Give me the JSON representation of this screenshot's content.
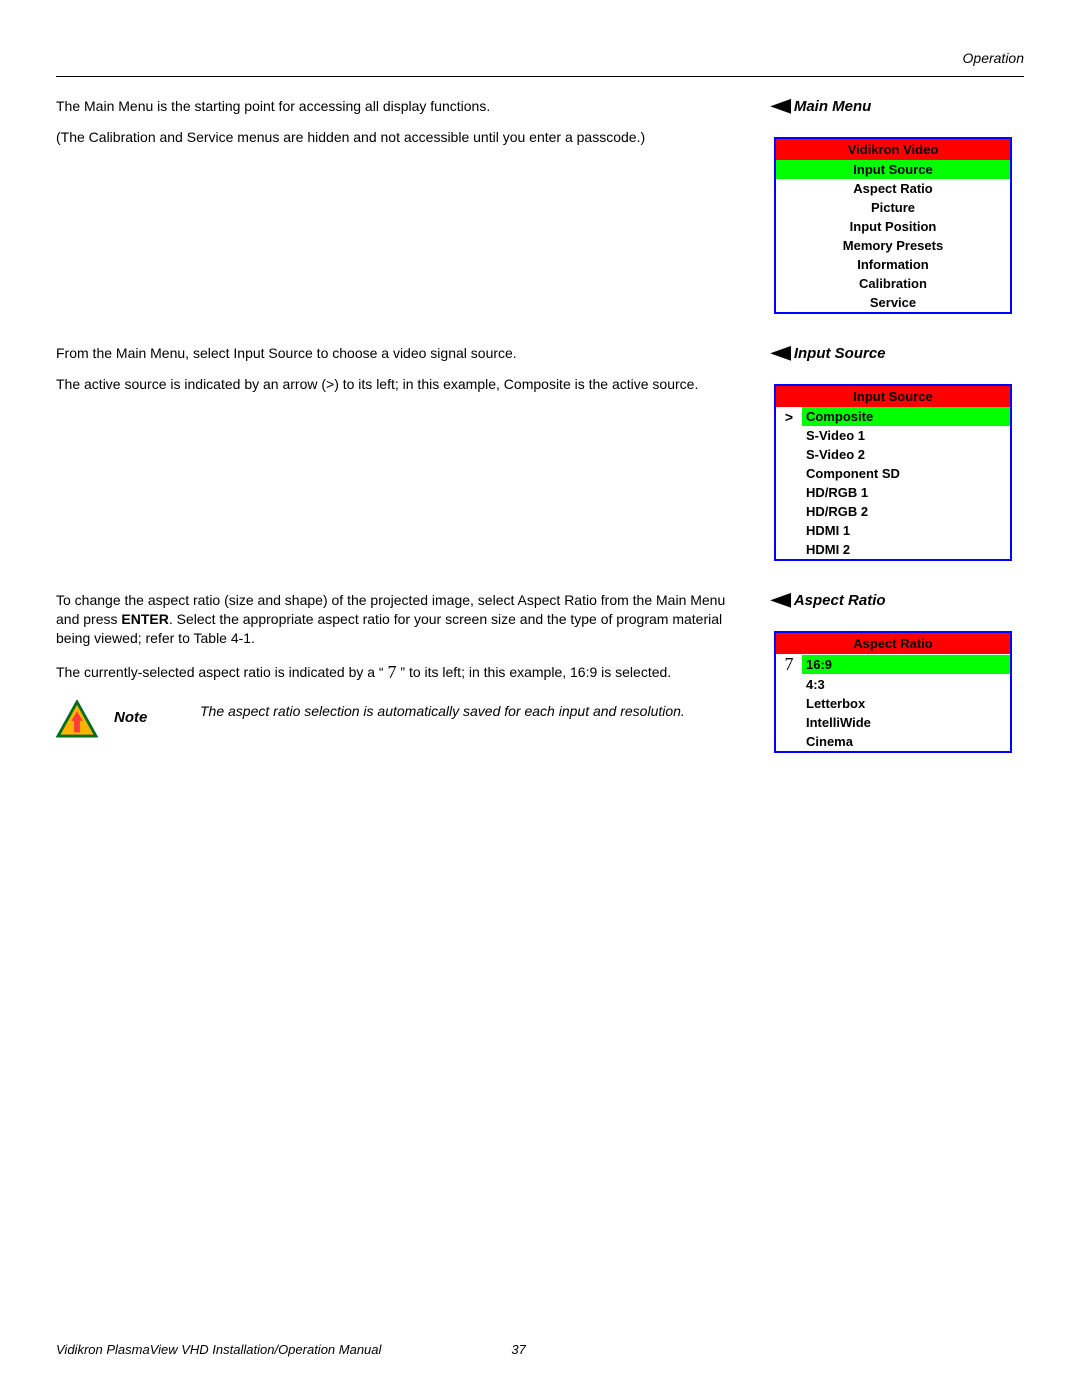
{
  "header": {
    "section": "Operation"
  },
  "sections": {
    "mainMenu": {
      "heading": "Main Menu",
      "para1": "The Main Menu is the starting point for accessing all display functions.",
      "para2": "(The Calibration and Service menus are hidden and not accessible until you enter a passcode.)",
      "menuTitle": "Vidikron Video",
      "items": [
        {
          "label": "Input Source",
          "selected": true
        },
        {
          "label": "Aspect Ratio",
          "selected": false
        },
        {
          "label": "Picture",
          "selected": false
        },
        {
          "label": "Input Position",
          "selected": false
        },
        {
          "label": "Memory Presets",
          "selected": false
        },
        {
          "label": "Information",
          "selected": false
        },
        {
          "label": "Calibration",
          "selected": false
        },
        {
          "label": "Service",
          "selected": false
        }
      ]
    },
    "inputSource": {
      "heading": "Input Source",
      "para1": "From the Main Menu, select Input Source to choose a video signal source.",
      "para2": "The active source is indicated by an arrow (>) to its left; in this example, Composite is the active source.",
      "menuTitle": "Input Source",
      "items": [
        {
          "indicator": ">",
          "label": "Composite",
          "selected": true
        },
        {
          "indicator": "",
          "label": "S-Video 1",
          "selected": false
        },
        {
          "indicator": "",
          "label": "S-Video 2",
          "selected": false
        },
        {
          "indicator": "",
          "label": "Component SD",
          "selected": false
        },
        {
          "indicator": "",
          "label": "HD/RGB 1",
          "selected": false
        },
        {
          "indicator": "",
          "label": "HD/RGB 2",
          "selected": false
        },
        {
          "indicator": "",
          "label": "HDMI 1",
          "selected": false
        },
        {
          "indicator": "",
          "label": "HDMI 2",
          "selected": false
        }
      ]
    },
    "aspectRatio": {
      "heading": "Aspect Ratio",
      "para1a": "To change the aspect ratio (size and shape) of the projected image, select Aspect Ratio from the Main Menu and press ",
      "para1bold": "ENTER",
      "para1b": ". Select the appropriate aspect ratio for your screen size and the type of program material being viewed; refer to Table 4-1.",
      "para2a": "The currently-selected aspect ratio is indicated by a “ ",
      "para2sym": "7",
      "para2b": " ” to its left; in this example, 16:9 is selected.",
      "noteLabel": "Note",
      "noteText": "The aspect ratio selection is automatically saved for each input and resolution.",
      "menuTitle": "Aspect Ratio",
      "items": [
        {
          "indicator": "7",
          "label": "16:9",
          "selected": true
        },
        {
          "indicator": "",
          "label": "4:3",
          "selected": false
        },
        {
          "indicator": "",
          "label": "Letterbox",
          "selected": false
        },
        {
          "indicator": "",
          "label": "IntelliWide",
          "selected": false
        },
        {
          "indicator": "",
          "label": "Cinema",
          "selected": false
        }
      ]
    }
  },
  "footer": {
    "title": "Vidikron PlasmaView VHD Installation/Operation Manual",
    "page": "37"
  }
}
